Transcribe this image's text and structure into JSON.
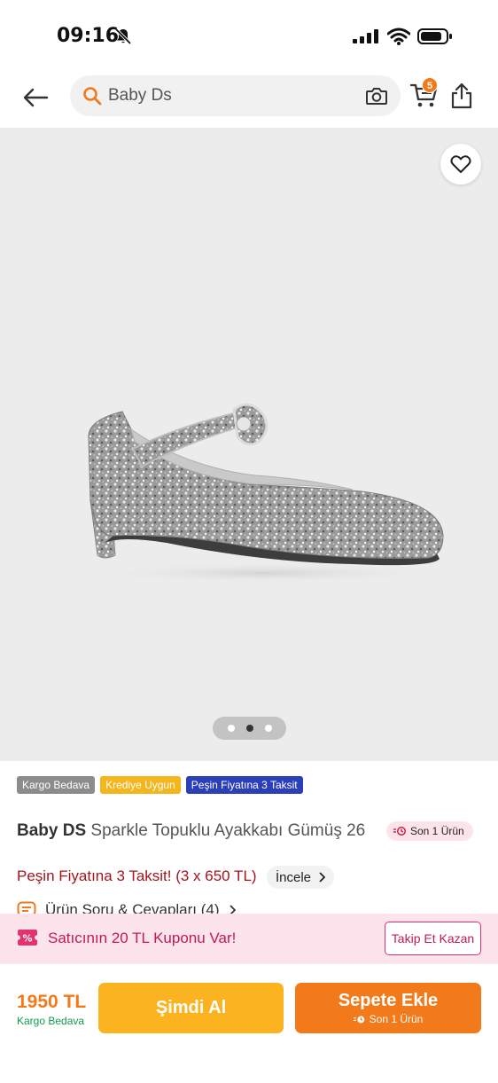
{
  "status_bar": {
    "time": "09:16"
  },
  "header": {
    "search_text": "Baby Ds",
    "cart_count": "5"
  },
  "gallery": {
    "image_count": 3,
    "active_index": 1
  },
  "badges": [
    {
      "label": "Kargo Bedava",
      "color": "#8c8c8c"
    },
    {
      "label": "Krediye Uygun",
      "color": "#f5b51d"
    },
    {
      "label": "Peşin Fiyatına 3 Taksit",
      "color": "#2a3fb8"
    }
  ],
  "product": {
    "brand": "Baby DS",
    "name": "Sparkle Topuklu Ayakkabı Gümüş 26",
    "stock_label": "Son 1 Ürün"
  },
  "installment": {
    "text": "Peşin Fiyatına 3 Taksit! (3 x 650 TL)",
    "link_label": "İncele"
  },
  "qa": {
    "label": "Ürün Soru & Cevapları (4)"
  },
  "coupon": {
    "text": "Satıcının 20 TL Kuponu Var!",
    "button_label": "Takip Et Kazan"
  },
  "bottom_bar": {
    "price": "1950 TL",
    "shipping": "Kargo Bedava",
    "buy_now_label": "Şimdi Al",
    "add_to_cart_label": "Sepete Ekle",
    "add_to_cart_sub": "Son 1 Ürün"
  },
  "colors": {
    "accent": "#f27a1a",
    "buy_now": "#fbb41f",
    "coupon": "#c31a52",
    "installment": "#a6141c"
  }
}
